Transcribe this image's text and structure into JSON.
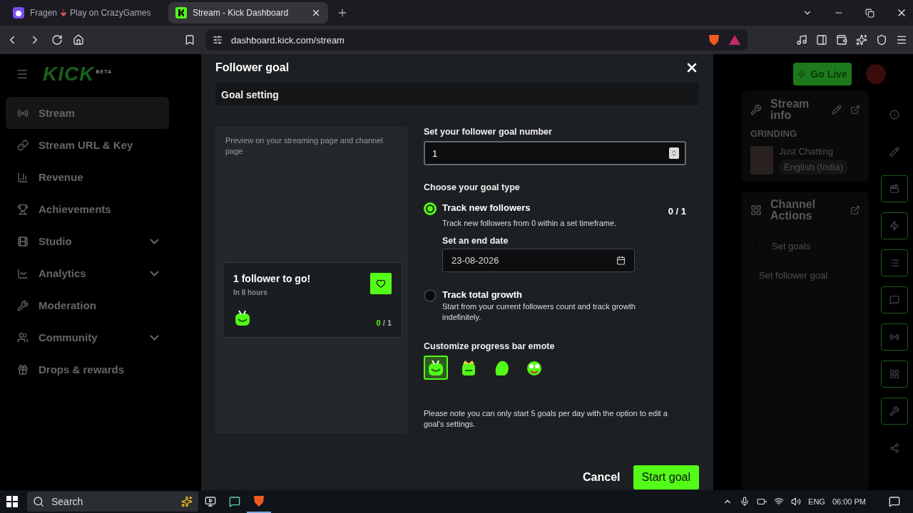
{
  "browser": {
    "tabs": [
      {
        "title_before": "Fragen",
        "title_after": "Play on CrazyGames",
        "selected": false,
        "kind": "game"
      },
      {
        "title_before": "Stream - Kick Dashboard",
        "selected": true,
        "kind": "kick"
      }
    ],
    "address": "dashboard.kick.com/stream"
  },
  "logo": {
    "text": "KICK",
    "badge": "BETA"
  },
  "sidebar": {
    "items": [
      {
        "label": "Stream",
        "selected": true,
        "expandable": false,
        "kind": "stream"
      },
      {
        "label": "Stream URL & Key",
        "selected": false,
        "expandable": false,
        "kind": "link"
      },
      {
        "label": "Revenue",
        "selected": false,
        "expandable": false,
        "kind": "revenue"
      },
      {
        "label": "Achievements",
        "selected": false,
        "expandable": false,
        "kind": "trophy"
      },
      {
        "label": "Studio",
        "selected": false,
        "expandable": true,
        "kind": "studio"
      },
      {
        "label": "Analytics",
        "selected": false,
        "expandable": true,
        "kind": "analytics"
      },
      {
        "label": "Moderation",
        "selected": false,
        "expandable": false,
        "kind": "wrench"
      },
      {
        "label": "Community",
        "selected": false,
        "expandable": true,
        "kind": "community"
      },
      {
        "label": "Drops & rewards",
        "selected": false,
        "expandable": false,
        "kind": "drops"
      }
    ]
  },
  "header": {
    "go_live": "Go Live"
  },
  "stream_info": {
    "title": "Stream info",
    "category": "GRINDING",
    "game": "Just Chatting",
    "language": "English (India)"
  },
  "channel_actions": {
    "title": "Channel Actions",
    "back": "Set goals",
    "item": "Set follower goal"
  },
  "modal": {
    "title": "Follower goal",
    "section": "Goal setting",
    "preview": {
      "caption": "Preview on your streaming page and channel page",
      "card_title": "1 follower to go!",
      "card_subtitle": "In 8 hours",
      "progress_done": "0",
      "progress_rest": "/ 1"
    },
    "goal_number": {
      "label": "Set your follower goal number",
      "value": "1"
    },
    "goal_type": {
      "label": "Choose your goal type",
      "options": [
        {
          "title": "Track new followers",
          "description": "Track new followers from 0 within a set timeframe.",
          "selected": true,
          "progress": "0 / 1",
          "end_date_label": "Set an end date",
          "end_date": "23-08-2026"
        },
        {
          "title": "Track total growth",
          "description": "Start from your current followers count and track growth indefinitely.",
          "selected": false
        }
      ]
    },
    "emote": {
      "label": "Customize progress bar emote",
      "options": [
        {
          "selected": true,
          "kind": "smile"
        },
        {
          "selected": false,
          "kind": "crown"
        },
        {
          "selected": false,
          "kind": "blob"
        },
        {
          "selected": false,
          "kind": "frog"
        }
      ]
    },
    "note": "Please note you can only start 5 goals per day with the option to edit a goal's settings.",
    "cancel": "Cancel",
    "submit": "Start goal"
  },
  "taskbar": {
    "search": "Search",
    "language": "ENG",
    "time": "06:00 PM"
  }
}
